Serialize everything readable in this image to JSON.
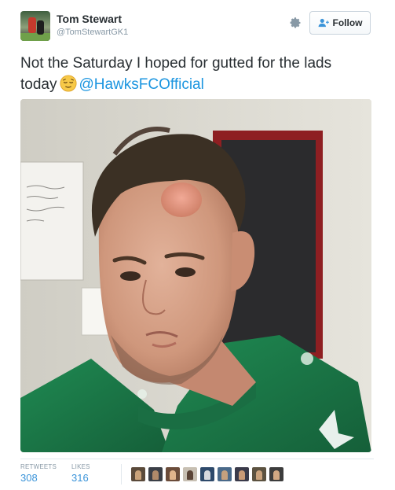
{
  "tweet": {
    "author_name": "Tom Stewart",
    "author_handle": "@TomStewartGK1",
    "text_line1": "Not the Saturday I hoped for gutted for the lads",
    "text_line2_prefix": "today",
    "mention": "@HawksFCOfficial",
    "emoji": "relieved-face-emoji"
  },
  "actions": {
    "follow_label": "Follow",
    "settings_icon": "gear-icon",
    "follow_icon": "add-user-icon"
  },
  "stats": {
    "retweets_label": "RETWEETS",
    "retweets_count": "308",
    "likes_label": "LIKES",
    "likes_count": "316"
  },
  "liker_avatars": [
    {
      "bg": "#5a4a3a",
      "fg": "#c9a27a"
    },
    {
      "bg": "#3b3f47",
      "fg": "#b08a6a"
    },
    {
      "bg": "#6b4c3a",
      "fg": "#e0b48c"
    },
    {
      "bg": "#c7bfb2",
      "fg": "#5a4436"
    },
    {
      "bg": "#2e4a6b",
      "fg": "#d6d9de"
    },
    {
      "bg": "#4a6a8a",
      "fg": "#c4a07e"
    },
    {
      "bg": "#3a3a4a",
      "fg": "#c99a76"
    },
    {
      "bg": "#5c5240",
      "fg": "#caa27c"
    },
    {
      "bg": "#3c3c3c",
      "fg": "#d1a883"
    }
  ],
  "colors": {
    "link": "#1b95e0",
    "count": "#3b94d9",
    "muted": "#8899a6",
    "text": "#292f33",
    "jersey": "#1c7a4a"
  }
}
